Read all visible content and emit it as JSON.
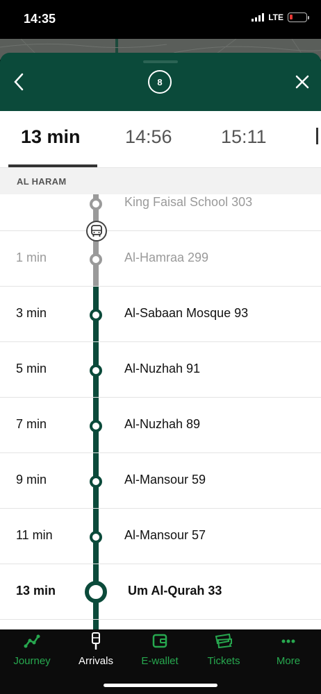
{
  "status_bar": {
    "time": "14:35",
    "network": "LTE"
  },
  "header": {
    "route_number": "8"
  },
  "time_tabs": [
    {
      "label": "13 min",
      "active": true
    },
    {
      "label": "14:56",
      "active": false
    },
    {
      "label": "15:11",
      "active": false
    }
  ],
  "direction": "AL HARAM",
  "stops": [
    {
      "time": "",
      "name": "King Faisal School 303",
      "state": "passed"
    },
    {
      "time": "1 min",
      "name": "Al-Hamraa 299",
      "state": "passed"
    },
    {
      "time": "3 min",
      "name": "Al-Sabaan Mosque 93",
      "state": "upcoming"
    },
    {
      "time": "5 min",
      "name": "Al-Nuzhah 91",
      "state": "upcoming"
    },
    {
      "time": "7 min",
      "name": "Al-Nuzhah 89",
      "state": "upcoming"
    },
    {
      "time": "9 min",
      "name": "Al-Mansour 59",
      "state": "upcoming"
    },
    {
      "time": "11 min",
      "name": "Al-Mansour 57",
      "state": "upcoming"
    },
    {
      "time": "13 min",
      "name": "Um Al-Qurah 33",
      "state": "destination"
    }
  ],
  "bottom_nav": [
    {
      "label": "Journey",
      "icon": "journey-icon",
      "active": false
    },
    {
      "label": "Arrivals",
      "icon": "bus-stop-icon",
      "active": true
    },
    {
      "label": "E-wallet",
      "icon": "wallet-icon",
      "active": false
    },
    {
      "label": "Tickets",
      "icon": "tickets-icon",
      "active": false
    },
    {
      "label": "More",
      "icon": "more-icon",
      "active": false
    }
  ],
  "colors": {
    "brand_green": "#0b4a3a",
    "nav_green": "#27a84f",
    "passed_grey": "#9a9a9a",
    "battery_low": "#e53935"
  }
}
